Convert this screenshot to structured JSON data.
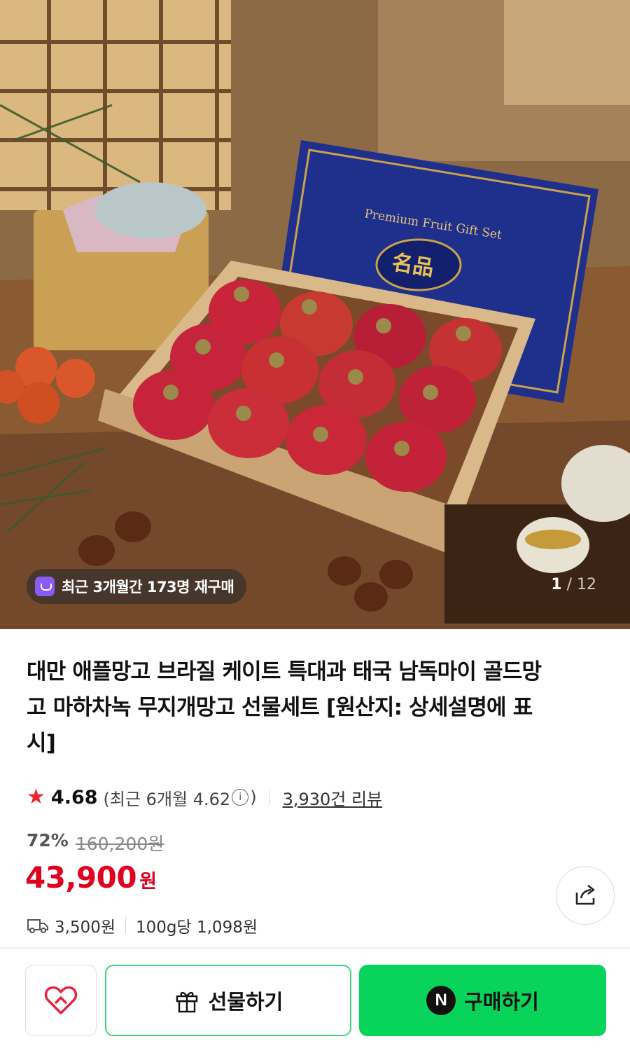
{
  "hero": {
    "image_label": "mango gift box photo",
    "box_text": "Premium Fruit Gift Set",
    "box_emblem": "名品",
    "badge_text": "최근 3개월간 173명 재구매",
    "pager_current": "1",
    "pager_sep": "/",
    "pager_total": "12"
  },
  "product": {
    "title": "대만 애플망고 브라질 케이트 특대과 태국 남독마이 골드망고 마하차녹 무지개망고 선물세트 [원산지: 상세설명에 표시]",
    "rating": "4.68",
    "recent_rating_open": "(최근 6개월 4.62",
    "recent_rating_close": ")",
    "info_icon": "i",
    "reviews": "3,930건 리뷰",
    "discount_rate": "72%",
    "original_price": "160,200원",
    "price": "43,900",
    "price_unit": "원",
    "shipping_fee": "3,500원",
    "unit_price": "100g당 1,098원"
  },
  "actions": {
    "gift_label": "선물하기",
    "buy_logo": "N",
    "buy_label": "구매하기"
  },
  "colors": {
    "price_red": "#e1001e",
    "star_red": "#f0242b",
    "buy_green": "#08d35a",
    "gift_border": "#3fd47a",
    "badge_purple": "#8a5cf5"
  }
}
